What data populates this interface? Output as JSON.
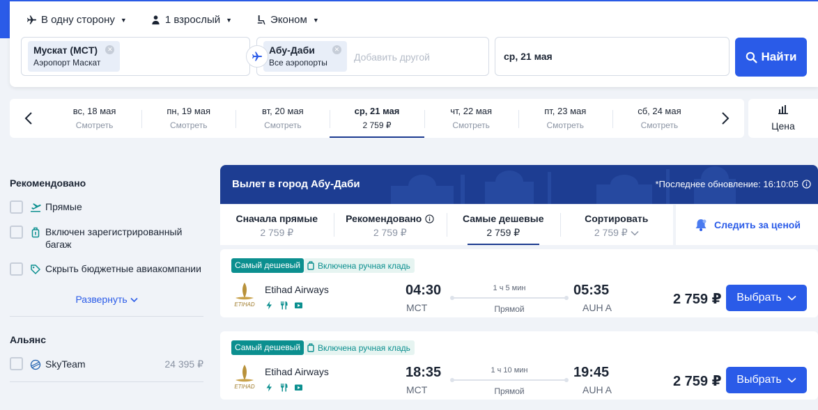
{
  "search": {
    "trip_type": "В одну сторону",
    "passengers": "1 взрослый",
    "cabin_class": "Эконом",
    "origin": {
      "name": "Мускат (MCT)",
      "sub": "Аэропорт Маскат"
    },
    "destination": {
      "name": "Абу-Даби",
      "sub": "Все аэропорты"
    },
    "add_other_placeholder": "Добавить другой",
    "date": "ср, 21 мая",
    "find_button": "Найти"
  },
  "datebar": {
    "dates": [
      {
        "day": "вс, 18 мая",
        "sub": "Смотреть"
      },
      {
        "day": "пн, 19 мая",
        "sub": "Смотреть"
      },
      {
        "day": "вт, 20 мая",
        "sub": "Смотреть"
      },
      {
        "day": "ср, 21 мая",
        "sub": "2 759 ₽"
      },
      {
        "day": "чт, 22 мая",
        "sub": "Смотреть"
      },
      {
        "day": "пт, 23 мая",
        "sub": "Смотреть"
      },
      {
        "day": "сб, 24 мая",
        "sub": "Смотреть"
      }
    ],
    "price_button": "Цена"
  },
  "filters": {
    "recommended_title": "Рекомендовано",
    "recommended": [
      "Прямые",
      "Включен зарегистрированный багаж",
      "Скрыть бюджетные авиакомпании"
    ],
    "expand": "Развернуть",
    "alliance_title": "Альянс",
    "alliance": {
      "name": "SkyTeam",
      "price": "24 395 ₽"
    }
  },
  "results": {
    "banner_title": "Вылет в город Абу-Даби",
    "last_update": "*Последнее обновление: 16:10:05",
    "sort": [
      {
        "label": "Сначала прямые",
        "price": "2 759 ₽"
      },
      {
        "label": "Рекомендовано",
        "price": "2 759 ₽"
      },
      {
        "label": "Самые дешевые",
        "price": "2 759 ₽"
      },
      {
        "label": "Сортировать",
        "price": "2 759 ₽"
      }
    ],
    "watch_price": "Следить за ценой",
    "flights": [
      {
        "badge": "Самый дешевый",
        "bag_badge": "Включена ручная кладь",
        "airline": "Etihad Airways",
        "logo_text": "ETIHAD",
        "dep_time": "04:30",
        "dep_airport": "MCT",
        "duration": "1 ч 5 мин",
        "stops": "Прямой",
        "arr_time": "05:35",
        "arr_airport": "AUH A",
        "price": "2 759 ₽",
        "choose": "Выбрать"
      },
      {
        "badge": "Самый дешевый",
        "bag_badge": "Включена ручная кладь",
        "airline": "Etihad Airways",
        "logo_text": "ETIHAD",
        "dep_time": "18:35",
        "dep_airport": "MCT",
        "duration": "1 ч 10 мин",
        "stops": "Прямой",
        "arr_time": "19:45",
        "arr_airport": "AUH A",
        "price": "2 759 ₽",
        "choose": "Выбрать"
      }
    ]
  },
  "colors": {
    "primary": "#2a5be8",
    "banner": "#1d3d92",
    "badge": "#0b8f8f"
  }
}
